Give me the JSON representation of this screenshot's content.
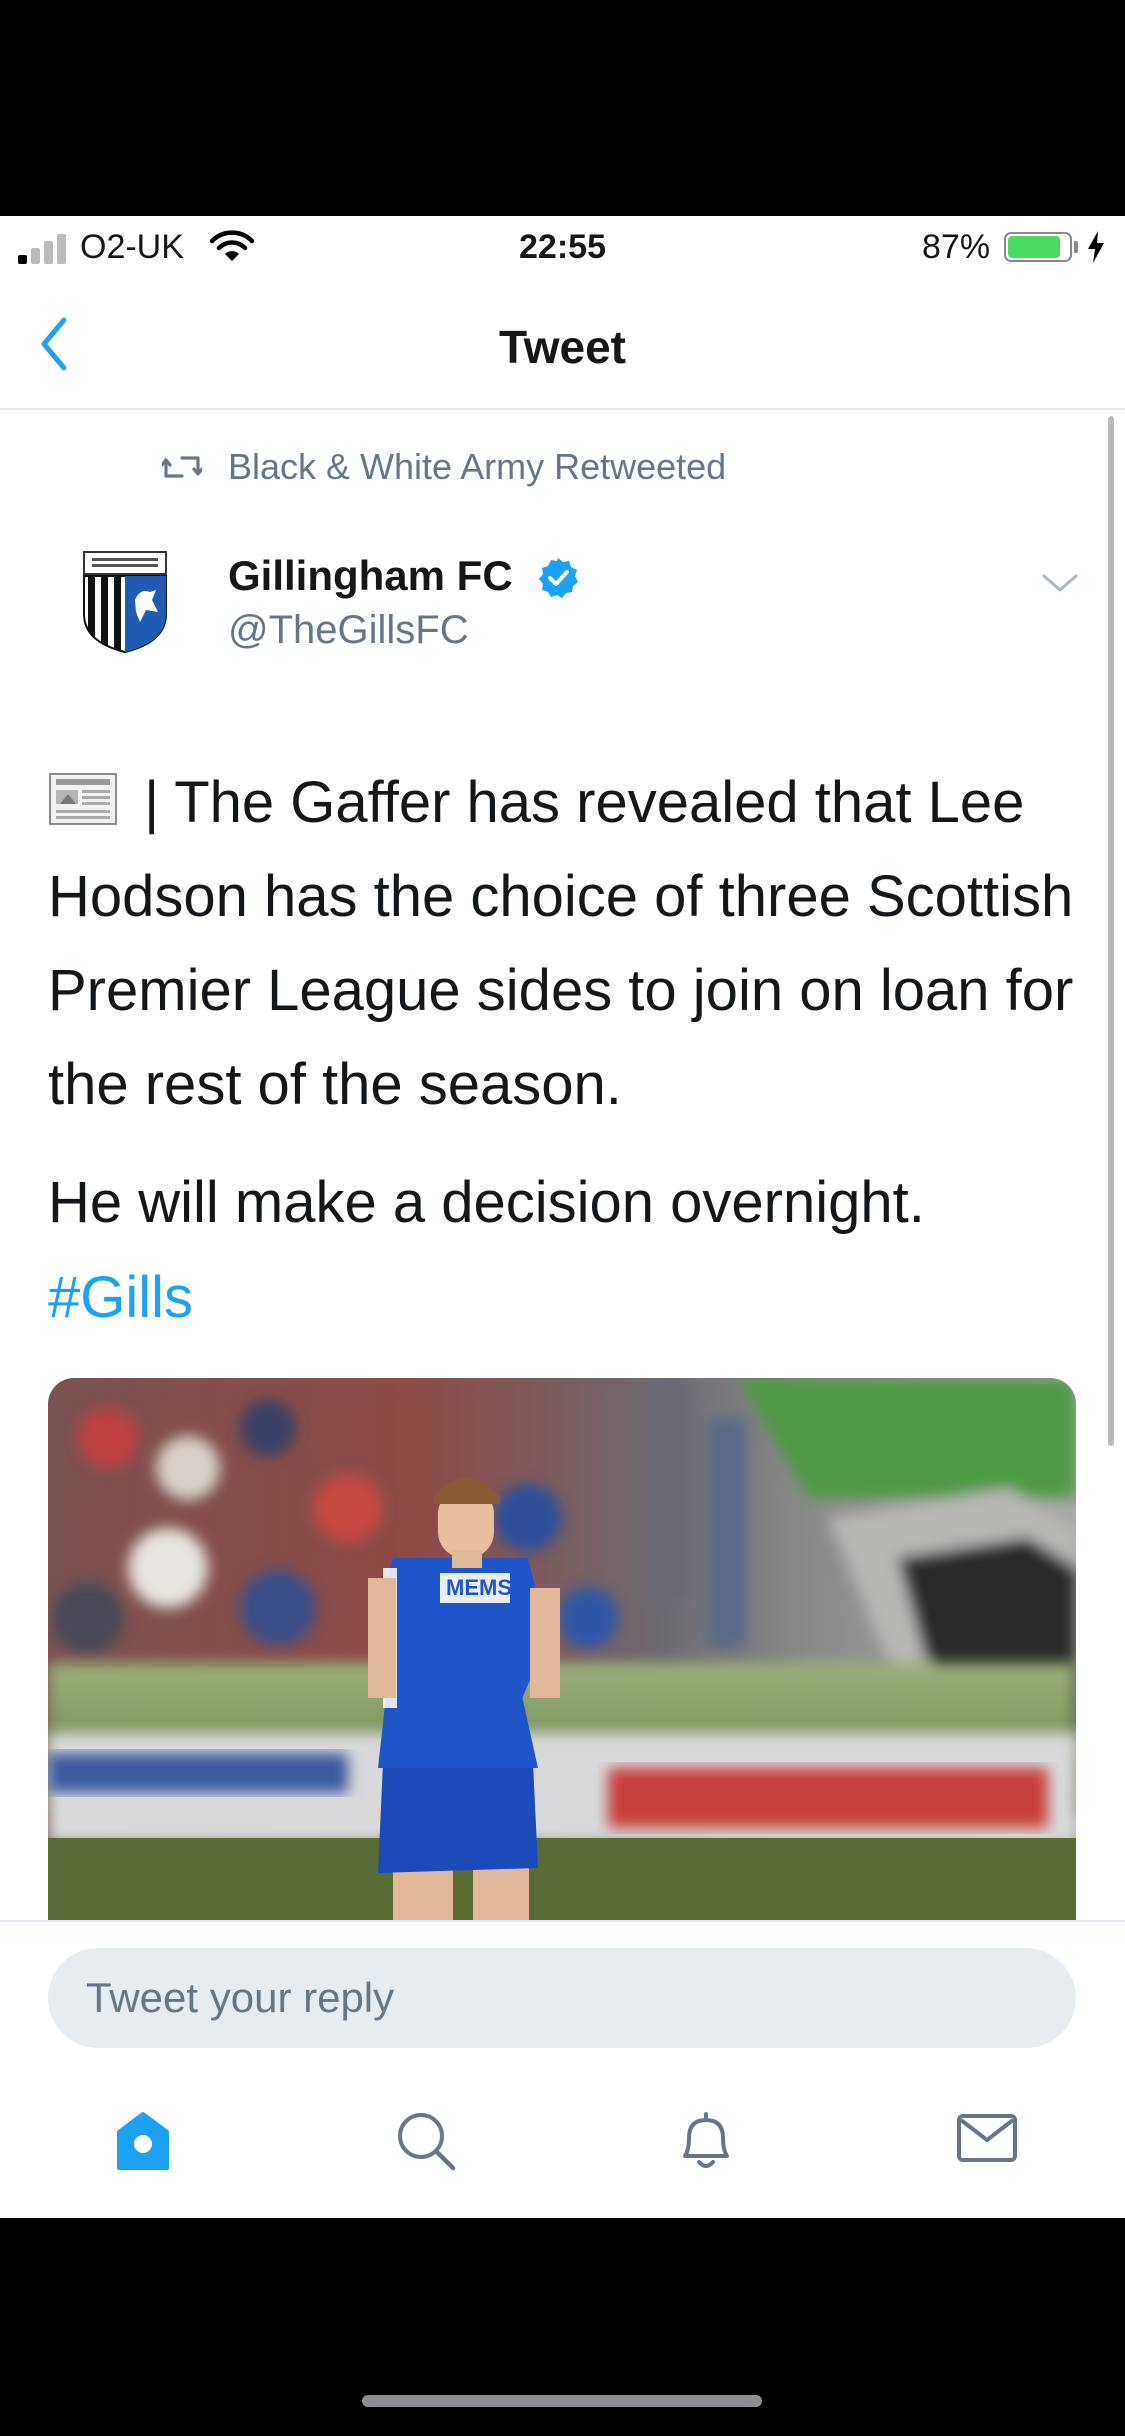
{
  "status_bar": {
    "carrier": "O2-UK",
    "time": "22:55",
    "battery_percent": "87%",
    "battery_level": 0.87,
    "signal_bars_active": 1,
    "signal_bars_total": 4
  },
  "nav": {
    "title": "Tweet",
    "back_icon": "chevron-left-icon",
    "accent_color": "#1da1f2"
  },
  "retweet": {
    "label": "Black & White Army Retweeted",
    "icon": "retweet-icon"
  },
  "author": {
    "display_name": "Gillingham FC",
    "handle": "@TheGillsFC",
    "verified": true,
    "avatar_icon": "gillingham-crest-icon"
  },
  "tweet": {
    "line1": " | The Gaffer has revealed that Lee Hodson has the choice of three Scottish Premier League sides to join on loan for the rest of the season.",
    "line2": "He will make a decision overnight.",
    "hashtag": "#Gills",
    "leading_emoji": "newspaper-icon",
    "photo": {
      "subject": "footballer in blue Gillingham kit",
      "shirt_sponsor": "MEMS"
    }
  },
  "reply": {
    "placeholder": "Tweet your reply"
  },
  "tabs": [
    {
      "name": "home",
      "icon": "home-icon",
      "active": true
    },
    {
      "name": "search",
      "icon": "search-icon",
      "active": false
    },
    {
      "name": "notifications",
      "icon": "bell-icon",
      "active": false
    },
    {
      "name": "messages",
      "icon": "mail-icon",
      "active": false
    }
  ],
  "colors": {
    "link": "#1da1f2",
    "secondary_text": "#657786",
    "tab_inactive": "#657786",
    "battery_green": "#4cd964"
  }
}
